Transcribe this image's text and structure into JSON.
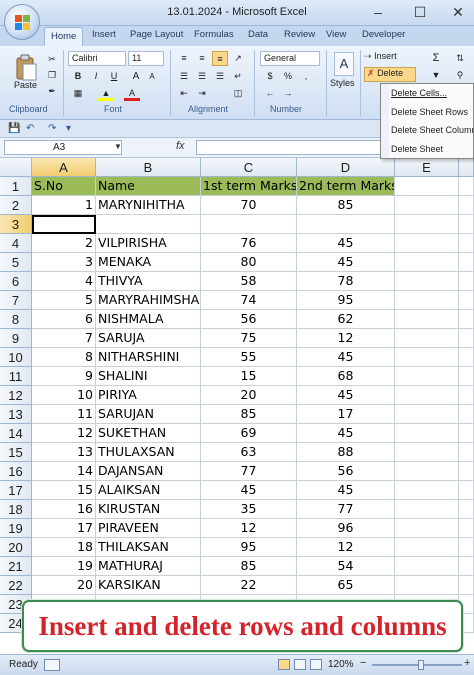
{
  "window": {
    "title": "13.01.2024 - Microsoft Excel"
  },
  "tabs": [
    {
      "label": "Home",
      "active": true
    },
    {
      "label": "Insert"
    },
    {
      "label": "Page Layout"
    },
    {
      "label": "Formulas"
    },
    {
      "label": "Data"
    },
    {
      "label": "Review"
    },
    {
      "label": "View"
    },
    {
      "label": "Developer"
    }
  ],
  "ribbon": {
    "paste_label": "Paste",
    "clipboard_label": "Clipboard",
    "font_name": "Calibri",
    "font_size": "11",
    "font_label": "Font",
    "alignment_label": "Alignment",
    "number_format": "General",
    "number_label": "Number",
    "styles_label": "Styles",
    "insert_label": "Insert",
    "delete_label": "Delete",
    "sum_icon": "Σ"
  },
  "delete_menu": [
    {
      "label": "Delete Cells...",
      "icon": "delete-cells-icon"
    },
    {
      "label": "Delete Sheet Rows",
      "icon": "delete-rows-icon"
    },
    {
      "label": "Delete Sheet Columns",
      "icon": "delete-columns-icon"
    },
    {
      "label": "Delete Sheet",
      "icon": "delete-sheet-icon"
    }
  ],
  "formula_bar": {
    "name_box": "A3",
    "fx_label": "fx",
    "formula": ""
  },
  "grid": {
    "columns": [
      "A",
      "B",
      "C",
      "D",
      "E"
    ],
    "headers": [
      "S.No",
      "Name",
      "1st term Marks",
      "2nd term Marks"
    ],
    "rows": [
      {
        "row": "1"
      },
      {
        "row": "2",
        "sno": "1",
        "name": "MARYNIHITHA",
        "m1": "70",
        "m2": "85"
      },
      {
        "row": "3",
        "sno": "",
        "name": "",
        "m1": "",
        "m2": ""
      },
      {
        "row": "4",
        "sno": "2",
        "name": "VILPIRISHA",
        "m1": "76",
        "m2": "45"
      },
      {
        "row": "5",
        "sno": "3",
        "name": "MENAKA",
        "m1": "80",
        "m2": "45"
      },
      {
        "row": "6",
        "sno": "4",
        "name": "THIVYA",
        "m1": "58",
        "m2": "78"
      },
      {
        "row": "7",
        "sno": "5",
        "name": "MARYRAHIMSHA",
        "m1": "74",
        "m2": "95"
      },
      {
        "row": "8",
        "sno": "6",
        "name": "NISHMALA",
        "m1": "56",
        "m2": "62"
      },
      {
        "row": "9",
        "sno": "7",
        "name": "SARUJA",
        "m1": "75",
        "m2": "12"
      },
      {
        "row": "10",
        "sno": "8",
        "name": "NITHARSHINI",
        "m1": "55",
        "m2": "45"
      },
      {
        "row": "11",
        "sno": "9",
        "name": "SHALINI",
        "m1": "15",
        "m2": "68"
      },
      {
        "row": "12",
        "sno": "10",
        "name": "PIRIYA",
        "m1": "20",
        "m2": "45"
      },
      {
        "row": "13",
        "sno": "11",
        "name": "SARUJAN",
        "m1": "85",
        "m2": "17"
      },
      {
        "row": "14",
        "sno": "12",
        "name": "SUKETHAN",
        "m1": "69",
        "m2": "45"
      },
      {
        "row": "15",
        "sno": "13",
        "name": "THULAXSAN",
        "m1": "63",
        "m2": "88"
      },
      {
        "row": "16",
        "sno": "14",
        "name": "DAJANSAN",
        "m1": "77",
        "m2": "56"
      },
      {
        "row": "17",
        "sno": "15",
        "name": "ALAIKSAN",
        "m1": "45",
        "m2": "45"
      },
      {
        "row": "18",
        "sno": "16",
        "name": "KIRUSTAN",
        "m1": "35",
        "m2": "77"
      },
      {
        "row": "19",
        "sno": "17",
        "name": "PIRAVEEN",
        "m1": "12",
        "m2": "96"
      },
      {
        "row": "20",
        "sno": "18",
        "name": "THILAKSAN",
        "m1": "95",
        "m2": "12"
      },
      {
        "row": "21",
        "sno": "19",
        "name": "MATHURAJ",
        "m1": "85",
        "m2": "54"
      },
      {
        "row": "22",
        "sno": "20",
        "name": "KARSIKAN",
        "m1": "22",
        "m2": "65"
      },
      {
        "row": "23"
      },
      {
        "row": "24"
      }
    ],
    "header_fill": "#9bbb59",
    "selected_cell": "A3"
  },
  "banner": {
    "text": "Insert and delete rows and columns",
    "color": "#d4232b",
    "border": "#3a8a52"
  },
  "status_bar": {
    "ready": "Ready",
    "zoom": "120%"
  }
}
